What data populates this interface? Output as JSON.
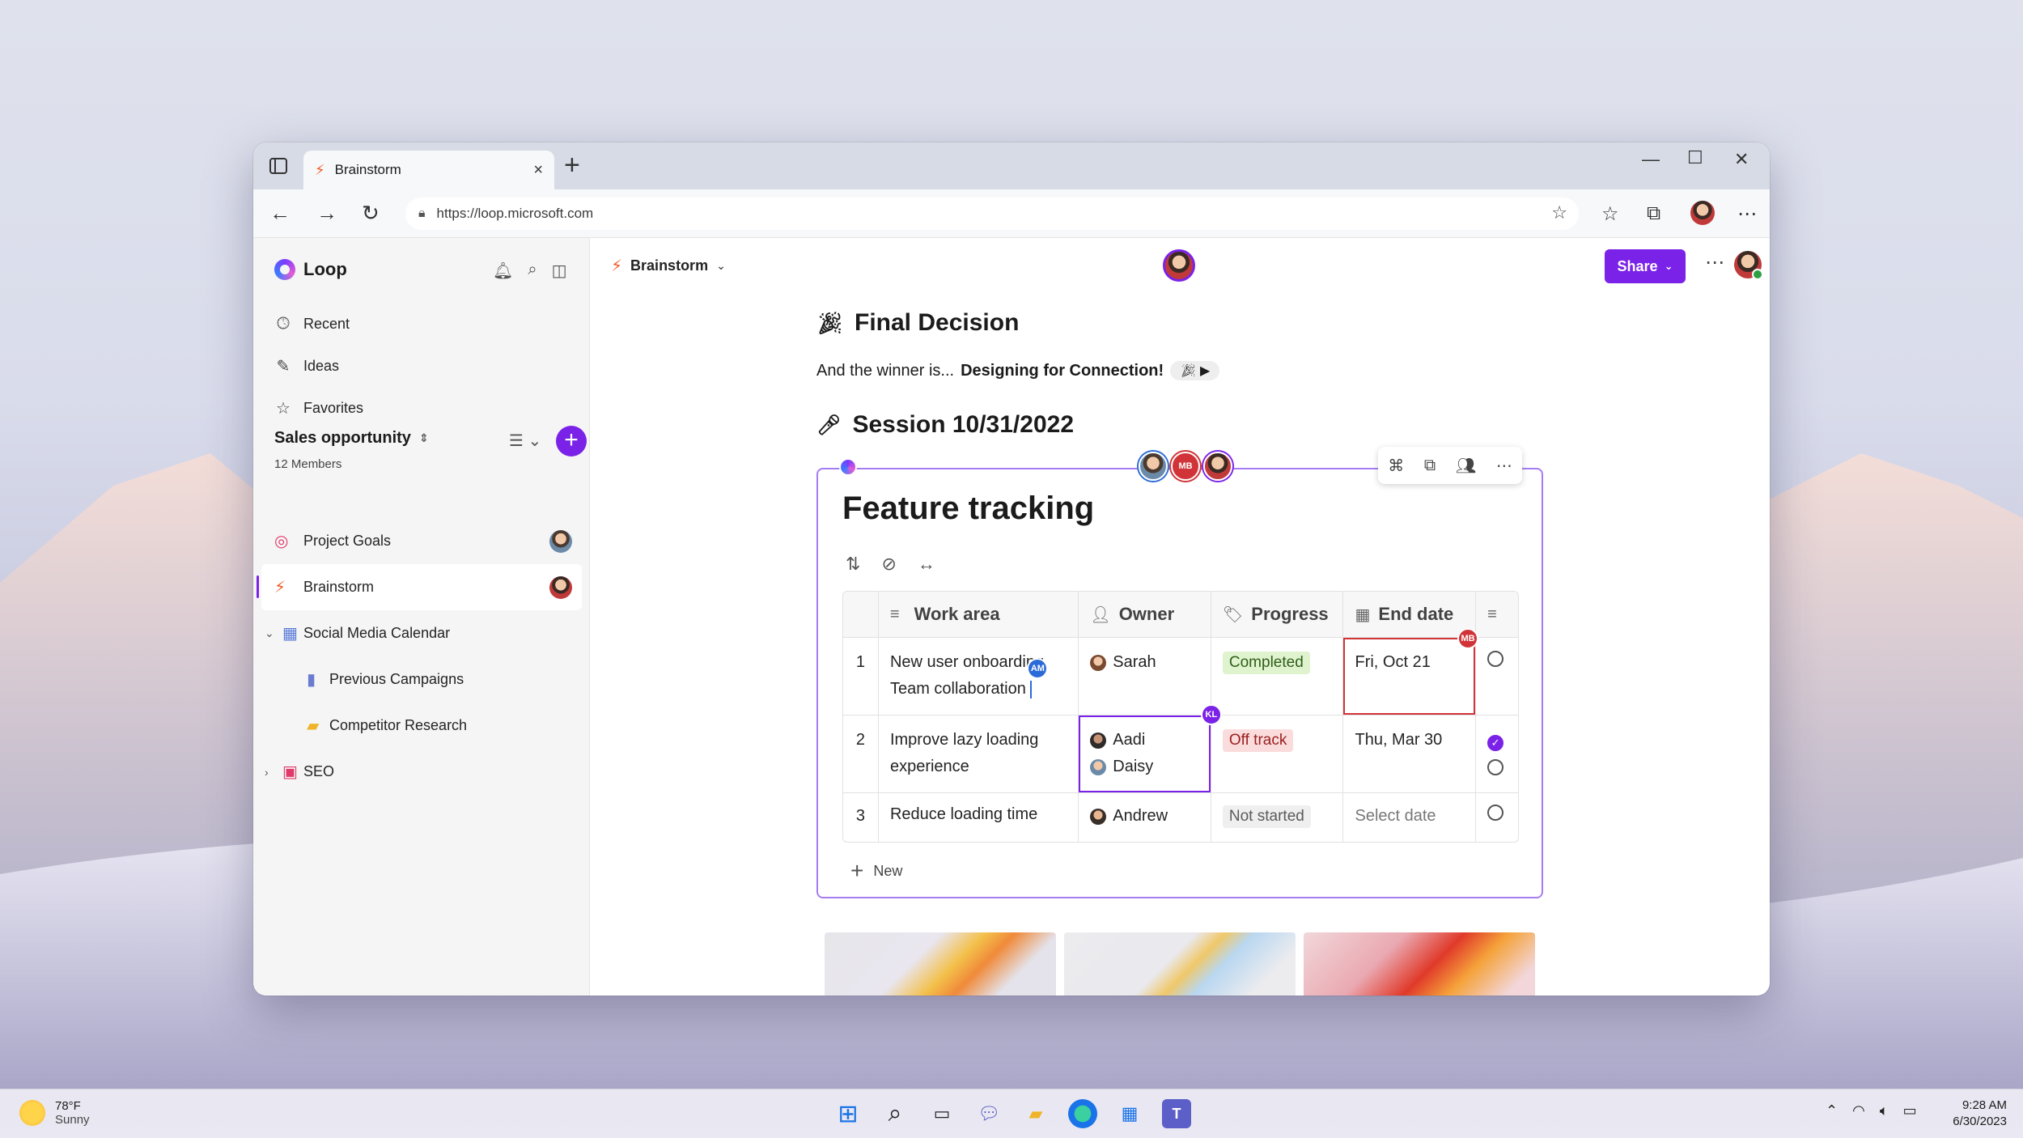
{
  "browser": {
    "tab_title": "Brainstorm",
    "url": "https://loop.microsoft.com"
  },
  "sidebar": {
    "app_name": "Loop",
    "nav": [
      {
        "label": "Recent",
        "icon": "clock-icon"
      },
      {
        "label": "Ideas",
        "icon": "pen-icon"
      },
      {
        "label": "Favorites",
        "icon": "star-icon"
      }
    ],
    "workspace": {
      "name": "Sales opportunity",
      "members": "12 Members"
    },
    "pages": [
      {
        "label": "Project Goals",
        "icon": "target-icon"
      },
      {
        "label": "Brainstorm",
        "icon": "bolt-icon"
      },
      {
        "label": "Social Media Calendar",
        "icon": "calendar-icon"
      },
      {
        "label": "Previous Campaigns",
        "icon": "chart-icon"
      },
      {
        "label": "Competitor Research",
        "icon": "folder-icon"
      },
      {
        "label": "SEO",
        "icon": "briefcase-icon"
      }
    ]
  },
  "header": {
    "page_name": "Brainstorm",
    "share_label": "Share"
  },
  "document": {
    "heading1": "Final Decision",
    "para_prefix": "And the winner is...",
    "para_bold": "Designing for Connection!",
    "heading2": "Session 10/31/2022"
  },
  "component": {
    "title": "Feature tracking",
    "presence": [
      "MB"
    ],
    "columns": [
      "Work area",
      "Owner",
      "Progress",
      "End date"
    ],
    "rows": [
      {
        "num": "1",
        "work_1": "New user onboarding,",
        "work_2": "Team collaboration",
        "owner_1": "Sarah",
        "progress": "Completed",
        "end": "Fri, Oct 21"
      },
      {
        "num": "2",
        "work_1": "Improve lazy loading",
        "work_2": "experience",
        "owner_1": "Aadi",
        "owner_2": "Daisy",
        "progress": "Off track",
        "end": "Thu, Mar 30"
      },
      {
        "num": "3",
        "work_1": "Reduce loading time",
        "owner_1": "Andrew",
        "progress": "Not started",
        "end": "Select date"
      }
    ],
    "cursors": {
      "am": "AM",
      "kl": "KL",
      "mb": "MB"
    },
    "new_label": "New"
  },
  "taskbar": {
    "temperature": "78°F",
    "condition": "Sunny",
    "time": "9:28 AM",
    "date": "6/30/2023"
  },
  "colors": {
    "accent": "#7b22e8",
    "completed_bg": "#dff3cf",
    "offtrack_bg": "#fbdcdc"
  }
}
